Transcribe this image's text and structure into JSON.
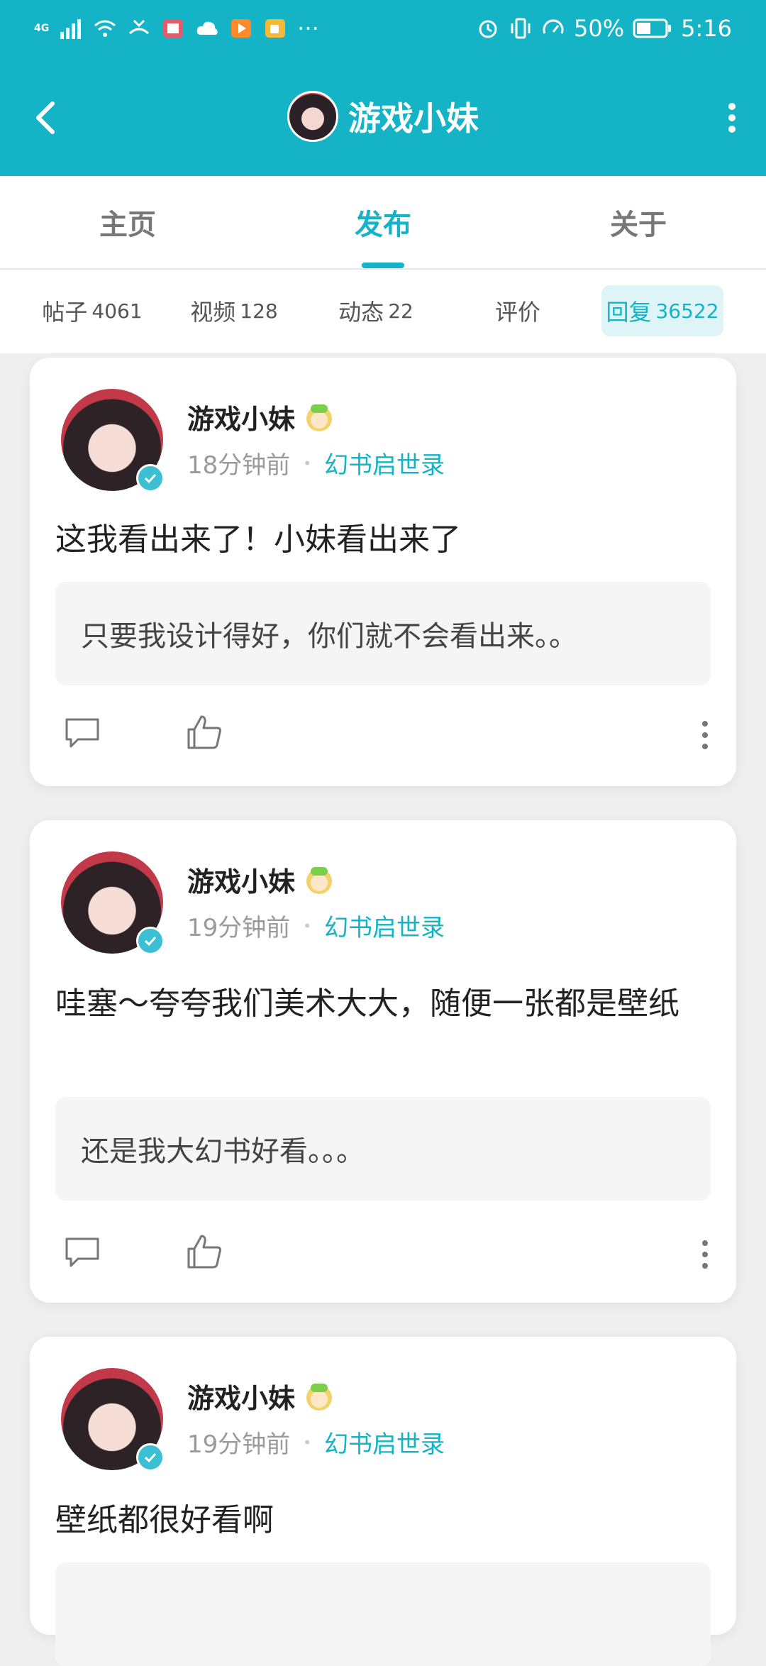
{
  "status_bar": {
    "network": "4G",
    "battery": "50%",
    "time": "5:16",
    "more": "···"
  },
  "header": {
    "title": "游戏小妹"
  },
  "tabs": [
    {
      "label": "主页",
      "active": false
    },
    {
      "label": "发布",
      "active": true
    },
    {
      "label": "关于",
      "active": false
    }
  ],
  "subtabs": [
    {
      "label": "帖子",
      "count": "4061"
    },
    {
      "label": "视频",
      "count": "128"
    },
    {
      "label": "动态",
      "count": "22"
    },
    {
      "label": "评价",
      "count": ""
    },
    {
      "label": "回复",
      "count": "36522"
    }
  ],
  "posts": [
    {
      "username": "游戏小妹",
      "time": "18分钟前",
      "separator": "•",
      "game": "幻书启世录",
      "text": "这我看出来了！小妹看出来了",
      "quote": "只要我设计得好，你们就不会看出来。。"
    },
    {
      "username": "游戏小妹",
      "time": "19分钟前",
      "separator": "•",
      "game": "幻书启世录",
      "text": "哇塞～夸夸我们美术大大，随便一张都是壁纸",
      "quote": "还是我大幻书好看。。。"
    },
    {
      "username": "游戏小妹",
      "time": "19分钟前",
      "separator": "•",
      "game": "幻书启世录",
      "text": "壁纸都很好看啊",
      "quote": ""
    }
  ],
  "colors": {
    "brand": "#14b4c6",
    "background": "#efefef"
  },
  "icons": [
    "back-arrow-icon",
    "more-vertical-icon",
    "comment-icon",
    "thumbs-up-icon",
    "verified-icon",
    "badge-icon"
  ]
}
